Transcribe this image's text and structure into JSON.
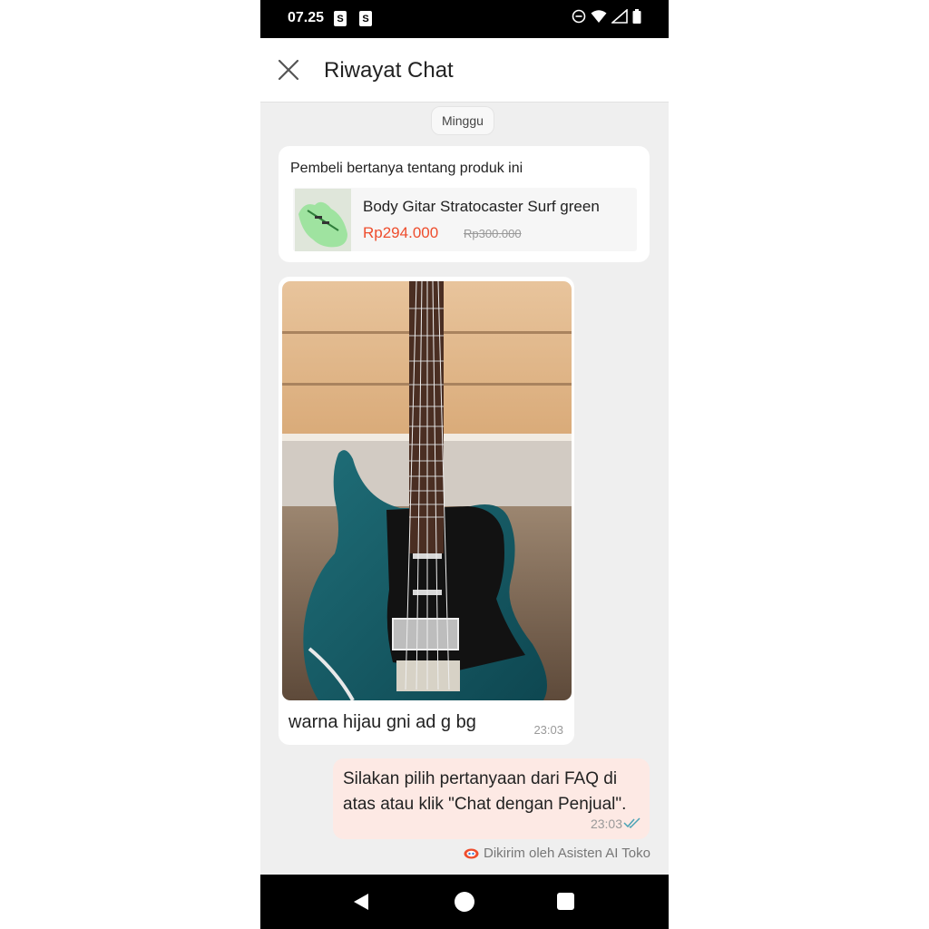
{
  "status_bar": {
    "time": "07.25",
    "notif_glyph": "S"
  },
  "header": {
    "title": "Riwayat Chat",
    "close_icon": "close-icon"
  },
  "chat": {
    "day_label": "Minggu",
    "product_card": {
      "title": "Pembeli bertanya tentang produk ini",
      "product_name": "Body Gitar Stratocaster Surf green",
      "price": "Rp294.000",
      "original_price": "Rp300.000"
    },
    "incoming": {
      "caption": "warna hijau gni ad g bg",
      "time": "23:03"
    },
    "outgoing": {
      "text": "Silakan pilih pertanyaan dari FAQ di atas atau klik \"Chat dengan Penjual\".",
      "time": "23:03"
    },
    "ai_note": "Dikirim oleh Asisten AI Toko"
  },
  "colors": {
    "accent": "#ee4d2d",
    "outgoing_bubble": "#fde9e4",
    "background": "#efefef"
  },
  "icons": [
    "close-icon",
    "wifi-icon",
    "signal-icon",
    "battery-icon",
    "dnd-icon",
    "double-check-icon",
    "ai-assistant-icon",
    "back-icon",
    "home-icon",
    "recents-icon"
  ]
}
